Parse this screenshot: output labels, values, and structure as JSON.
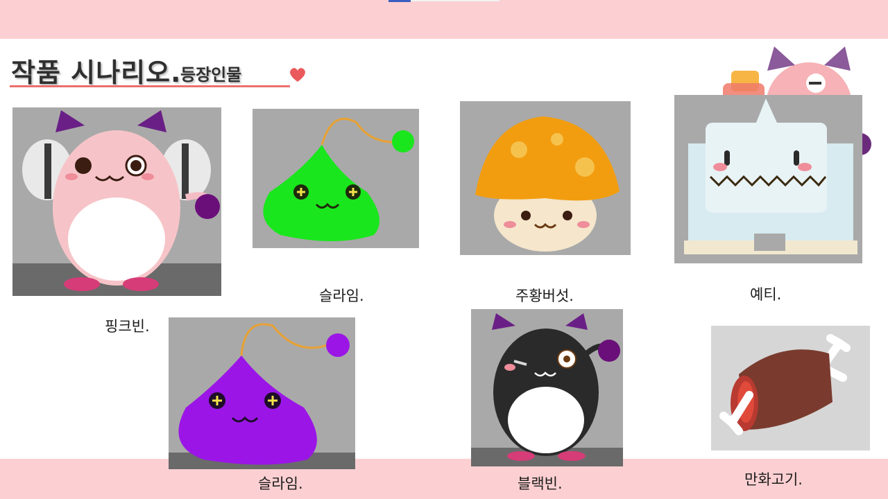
{
  "slide": {
    "title_main": "작품 시나리오.",
    "title_sub": "등장인물"
  },
  "characters": [
    {
      "name": "핑크빈.",
      "image": "pink-bean-character",
      "body_color": "#f6c4c8"
    },
    {
      "name": "슬라임.",
      "image": "green-slime-character",
      "body_color": "#19e61c"
    },
    {
      "name": "주황버섯.",
      "image": "orange-mushroom-character",
      "body_color": "#f29d10"
    },
    {
      "name": "예티.",
      "image": "yeti-character",
      "body_color": "#e8f3f5"
    },
    {
      "name": "슬라임.",
      "image": "purple-slime-character",
      "body_color": "#9b16e6"
    },
    {
      "name": "블랙빈.",
      "image": "black-bean-character",
      "body_color": "#2a2a2a"
    },
    {
      "name": "만화고기.",
      "image": "cartoon-meat-item",
      "body_color": "#7a3b2e"
    }
  ],
  "colors": {
    "band": "#fcd0d2",
    "underline": "#ea6f6d",
    "photo_bg": "#a9a9a9"
  }
}
